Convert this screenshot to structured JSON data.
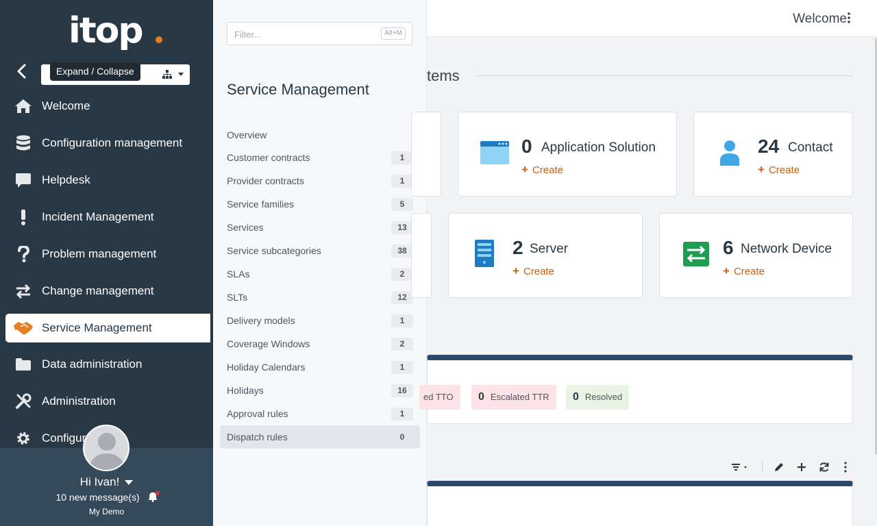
{
  "nav": {
    "logo_text": "itop",
    "tooltip": "Expand / Collapse",
    "items": [
      {
        "label": "Welcome",
        "icon": "home-icon"
      },
      {
        "label": "Configuration management",
        "icon": "database-icon"
      },
      {
        "label": "Helpdesk",
        "icon": "speech-bubble-icon"
      },
      {
        "label": "Incident Management",
        "icon": "exclamation-icon"
      },
      {
        "label": "Problem management",
        "icon": "question-icon"
      },
      {
        "label": "Change management",
        "icon": "exchange-arrows-icon"
      },
      {
        "label": "Service Management",
        "icon": "handshake-icon",
        "active": true
      },
      {
        "label": "Data administration",
        "icon": "folder-icon"
      },
      {
        "label": "Administration",
        "icon": "tools-icon"
      },
      {
        "label": "Configur",
        "icon": "gear-icon"
      }
    ],
    "user": {
      "greeting": "Hi Ivan!",
      "messages": "10 new message(s)",
      "org": "My Demo"
    }
  },
  "flyout": {
    "filter_placeholder": "Filter...",
    "filter_shortcut": "Alt+M",
    "title": "Service Management",
    "items": [
      {
        "label": "Overview",
        "count": ""
      },
      {
        "label": "Customer contracts",
        "count": "1"
      },
      {
        "label": "Provider contracts",
        "count": "1"
      },
      {
        "label": "Service families",
        "count": "5"
      },
      {
        "label": "Services",
        "count": "13"
      },
      {
        "label": "Service subcategories",
        "count": "38"
      },
      {
        "label": "SLAs",
        "count": "2"
      },
      {
        "label": "SLTs",
        "count": "12"
      },
      {
        "label": "Delivery models",
        "count": "1"
      },
      {
        "label": "Coverage Windows",
        "count": "2"
      },
      {
        "label": "Holiday Calendars",
        "count": "1"
      },
      {
        "label": "Holidays",
        "count": "16"
      },
      {
        "label": "Approval rules",
        "count": "1"
      },
      {
        "label": "Dispatch rules",
        "count": "0",
        "active": true
      }
    ]
  },
  "main": {
    "topbar_title": "Welcome",
    "section_title": "tems",
    "cards": [
      {
        "count": "0",
        "name": "Application Solution",
        "create": "Create",
        "icon": "application-window-icon"
      },
      {
        "count": "24",
        "name": "Contact",
        "create": "Create",
        "icon": "person-icon"
      },
      {
        "count": "2",
        "name": "Server",
        "create": "Create",
        "icon": "server-icon"
      },
      {
        "count": "6",
        "name": "Network Device",
        "create": "Create",
        "icon": "network-device-icon"
      }
    ],
    "chips": [
      {
        "count": "",
        "label": "ed TTO"
      },
      {
        "count": "0",
        "label": "Escalated TTR"
      },
      {
        "count": "0",
        "label": "Resolved"
      }
    ]
  },
  "colors": {
    "nav_bg": "#283845",
    "accent": "#ea7d1e",
    "create_link": "#c85f13",
    "panel_header": "#2d4a6a"
  }
}
